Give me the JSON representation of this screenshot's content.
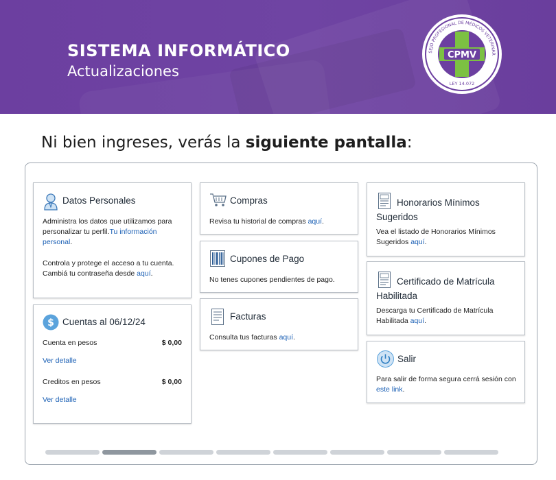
{
  "header": {
    "title": "SISTEMA INFORMÁTICO",
    "subtitle": "Actualizaciones",
    "background_color": "#6c3fa0"
  },
  "logo": {
    "center_text": "CPMV",
    "ring_text": "CONSEJO PROFESIONAL DE MÉDICOS VETERINARIOS",
    "law_text": "LEY 14.072",
    "cross_color": "#7cc142",
    "center_color": "#6c3fa0"
  },
  "intro": {
    "prefix": "Ni bien ingreses, verás la ",
    "bold": "siguiente pantalla",
    "suffix": ":"
  },
  "cards": {
    "datos": {
      "title": "Datos Personales",
      "icon": "user-icon",
      "text1": "Administra los datos que utilizamos para personalizar tu perfil.",
      "link1": "Tu información personal",
      "text1_end": ".",
      "text2": "Controla y protege el acceso a tu cuenta. Cambiá tu contraseña desde ",
      "link2": "aquí",
      "text2_end": "."
    },
    "cuentas": {
      "title": "Cuentas al 06/12/24",
      "icon": "dollar-icon",
      "row1_label": "Cuenta en pesos",
      "row1_value": "$ 0,00",
      "row1_link": "Ver detalle",
      "row2_label": "Creditos en pesos",
      "row2_value": "$ 0,00",
      "row2_link": "Ver detalle"
    },
    "compras": {
      "title": "Compras",
      "icon": "cart-icon",
      "text": "Revisa tu historial de compras ",
      "link": "aquí",
      "text_end": "."
    },
    "cupones": {
      "title": "Cupones de Pago",
      "icon": "barcode-icon",
      "text": "No tenes cupones pendientes de pago."
    },
    "facturas": {
      "title": "Facturas",
      "icon": "invoice-icon",
      "text": "Consulta tus facturas ",
      "link": "aquí",
      "text_end": "."
    },
    "honorarios": {
      "title": "Honorarios Mínimos Sugeridos",
      "icon": "document-icon",
      "text": "Vea el listado de Honorarios Mínimos Sugeridos ",
      "link": "aquí",
      "text_end": "."
    },
    "certificado": {
      "title": "Certificado de Matrícula Habilitada",
      "icon": "document-icon",
      "text": "Descarga tu Certificado de Matrícula Habilitada ",
      "link": "aquí",
      "text_end": "."
    },
    "salir": {
      "title": "Salir",
      "icon": "power-icon",
      "text": "Para salir de forma segura cerrá sesión con ",
      "link": "este link",
      "text_end": "."
    }
  }
}
